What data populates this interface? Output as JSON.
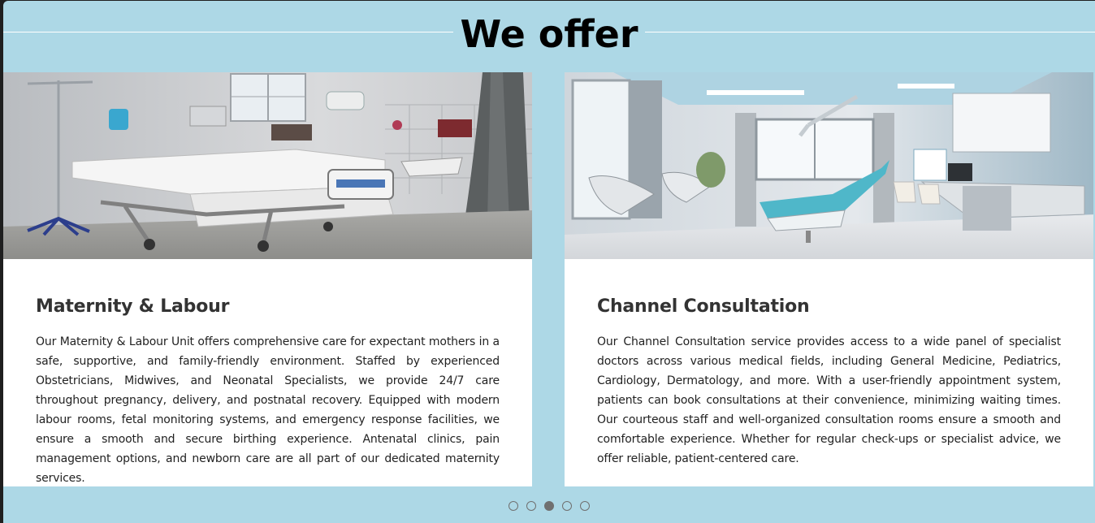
{
  "section": {
    "title": "We offer"
  },
  "cards": [
    {
      "title": "Maternity & Labour",
      "text": "Our Maternity & Labour Unit offers comprehensive care for expectant mothers in a safe, supportive, and family-friendly environment. Staffed by experienced Obstetricians, Midwives, and Neonatal Specialists, we provide 24/7 care throughout pregnancy, delivery, and postnatal recovery. Equipped with modern labour rooms, fetal monitoring systems, and emergency response facilities, we ensure a smooth and secure birthing experience. Antenatal clinics, pain management options, and newborn care are all part of our dedicated maternity services."
    },
    {
      "title": "Channel Consultation",
      "text": "Our Channel Consultation service provides access to a wide panel of specialist doctors across various medical fields, including General Medicine, Pediatrics, Cardiology, Dermatology, and more. With a user-friendly appointment system, patients can book consultations at their convenience, minimizing waiting times. Our courteous staff and well-organized consultation rooms ensure a smooth and comfortable experience. Whether for regular check-ups or specialist advice, we offer reliable, patient-centered care."
    }
  ],
  "carousel": {
    "dot_count": 5,
    "active_index": 2
  },
  "colors": {
    "background": "#add8e6",
    "card": "#ffffff",
    "dot": "#707070"
  }
}
